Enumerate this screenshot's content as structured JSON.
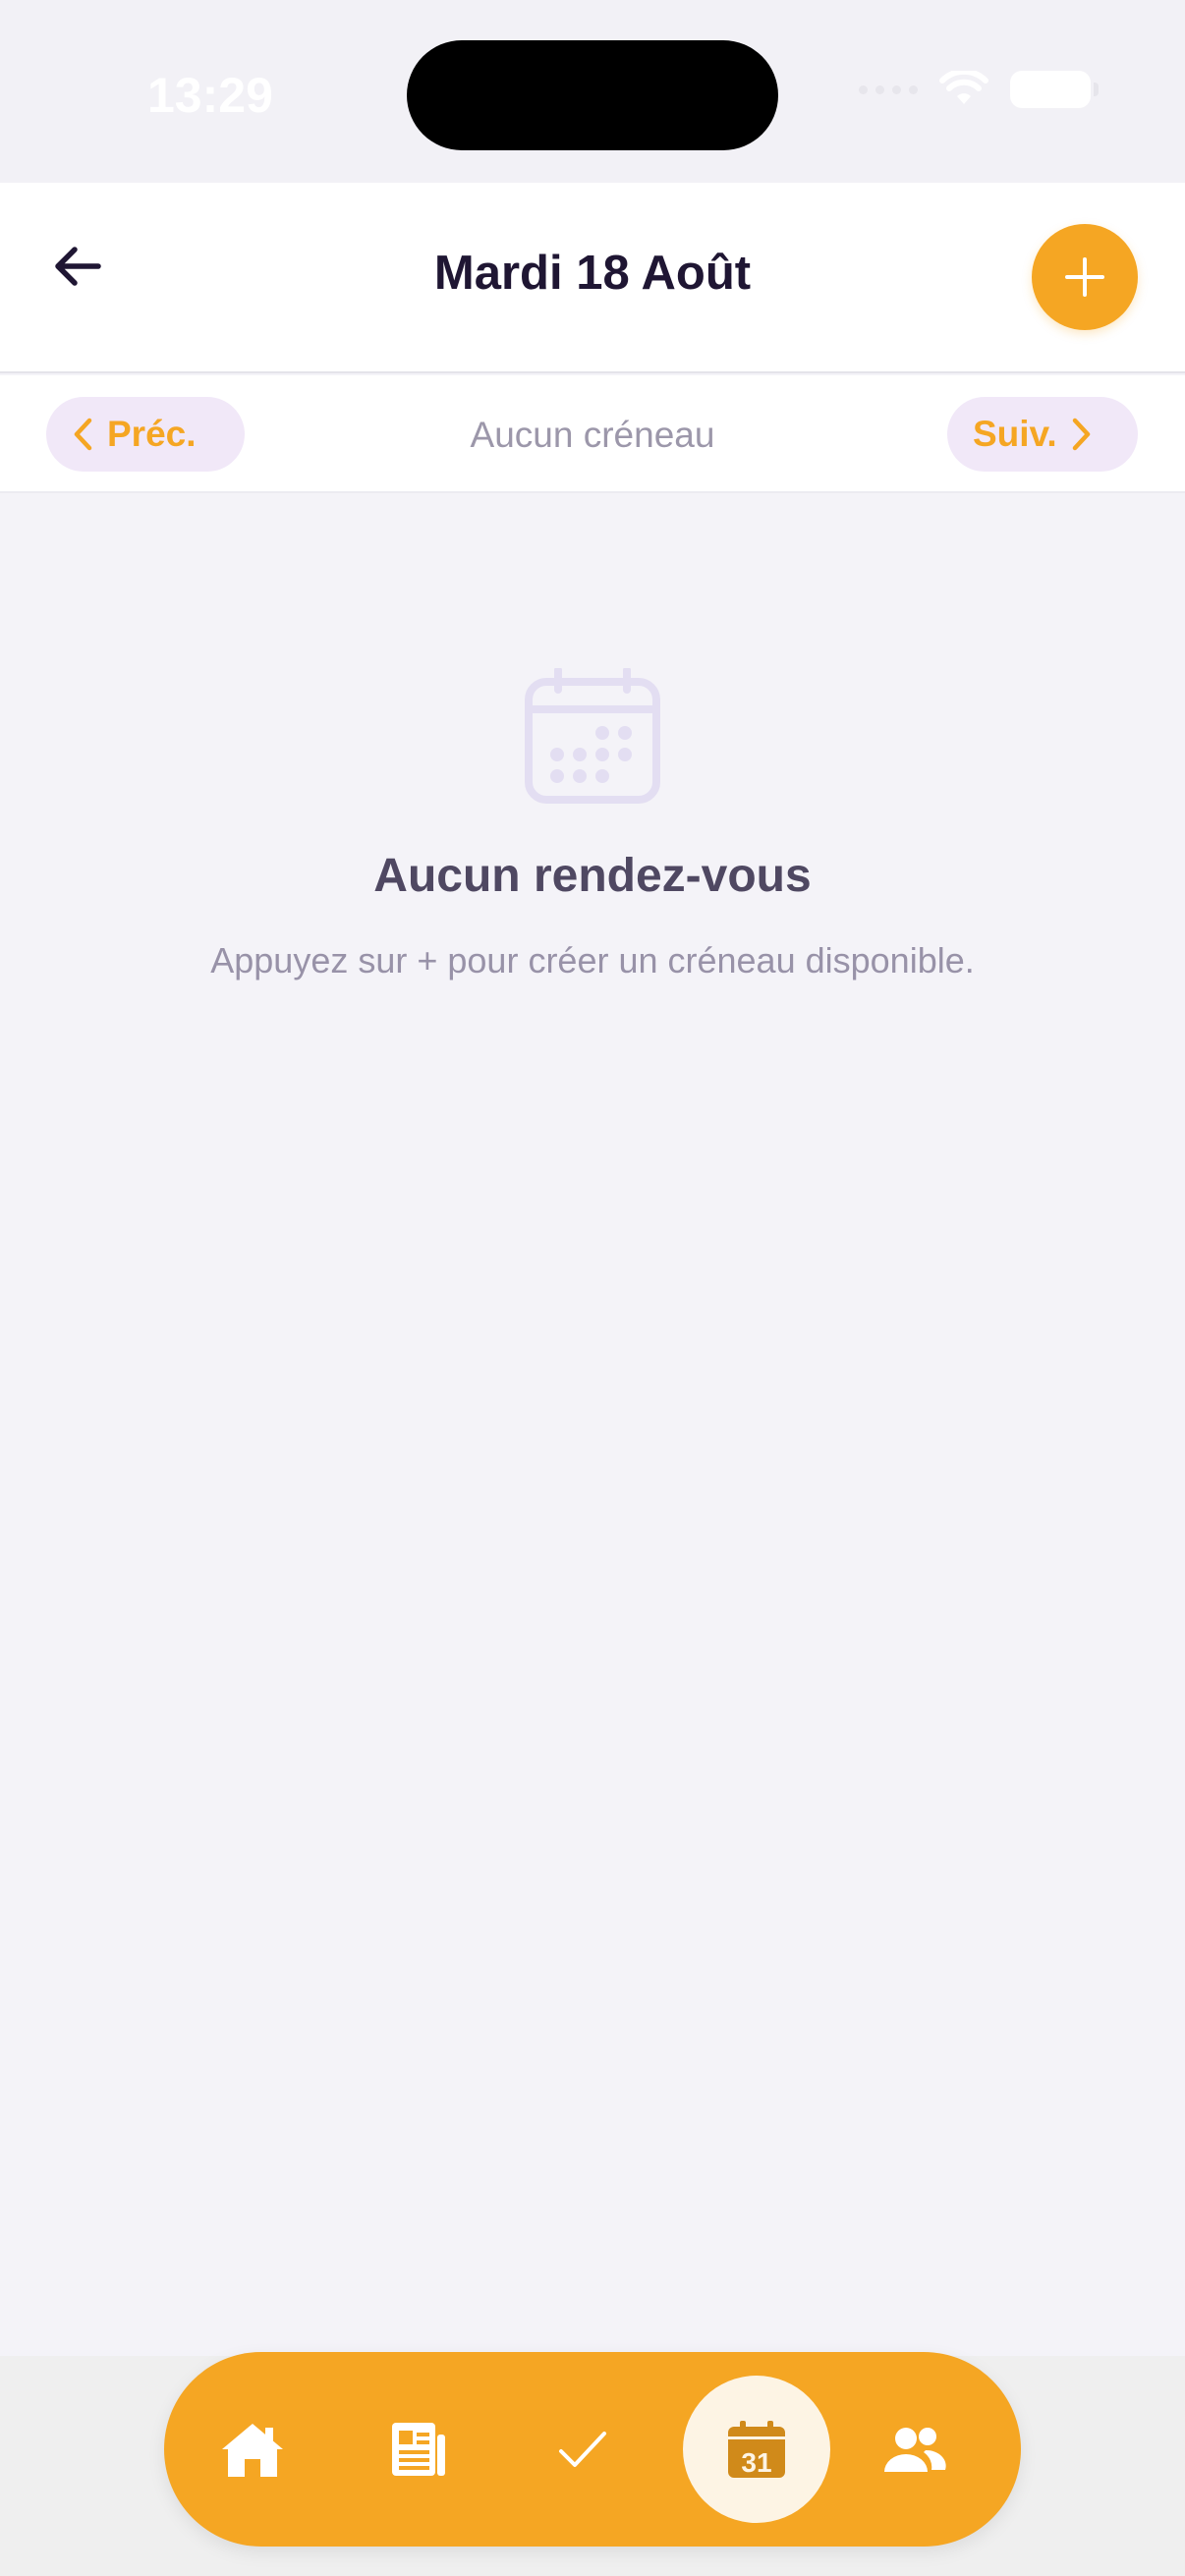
{
  "status_bar": {
    "time": "13:29"
  },
  "header": {
    "title": "Mardi 18 Août"
  },
  "day_nav": {
    "prev_label": "Préc.",
    "next_label": "Suiv.",
    "status": "Aucun créneau"
  },
  "empty_state": {
    "title": "Aucun rendez-vous",
    "subtitle": "Appuyez sur + pour créer un créneau disponible."
  },
  "tabbar": {
    "items": [
      {
        "icon": "home-icon",
        "active": false
      },
      {
        "icon": "newspaper-icon",
        "active": false
      },
      {
        "icon": "check-icon",
        "active": false
      },
      {
        "icon": "calendar-icon",
        "active": true,
        "label": "31"
      },
      {
        "icon": "users-icon",
        "active": false
      }
    ]
  },
  "colors": {
    "accent": "#f5a623",
    "title": "#1f1633",
    "pill_bg": "#f1e8f8",
    "background": "#f4f3f8"
  }
}
